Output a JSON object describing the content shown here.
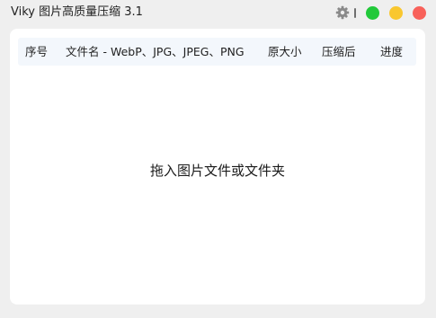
{
  "app": {
    "title": "Viky 图片高质量压缩 3.1"
  },
  "window_controls": {
    "settings_icon": "gear-icon",
    "buttons": [
      {
        "name": "maximize",
        "color": "#22c93a"
      },
      {
        "name": "minimize",
        "color": "#f9c72f"
      },
      {
        "name": "close",
        "color": "#f8615a"
      }
    ]
  },
  "table": {
    "columns": {
      "index": "序号",
      "filename": "文件名 - WebP、JPG、JPEG、PNG",
      "original_size": "原大小",
      "compressed_size": "压缩后",
      "progress": "进度"
    },
    "rows": []
  },
  "drop_zone": {
    "hint": "拖入图片文件或文件夹"
  },
  "colors": {
    "window_bg": "#efefef",
    "panel_bg": "#ffffff",
    "header_bg": "#f3f7fc"
  }
}
